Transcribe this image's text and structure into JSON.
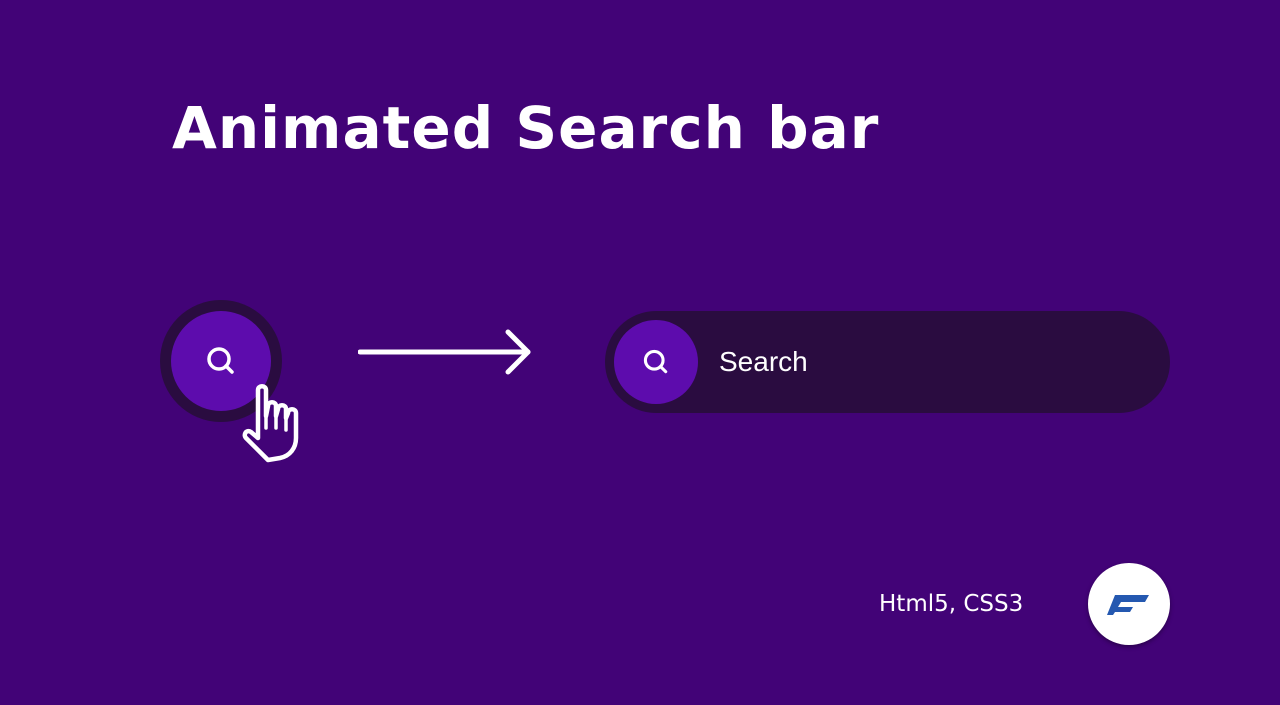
{
  "heading": {
    "title": "Animated Search bar"
  },
  "collapsed_search": {
    "icon": "search-icon",
    "cursor_icon": "hand-pointer-icon"
  },
  "transition_arrow": {
    "icon": "arrow-right-icon"
  },
  "expanded_search": {
    "icon": "search-icon",
    "placeholder": "Search"
  },
  "footer": {
    "tech_label": "Html5, CSS3",
    "logo_icon": "brand-logo-icon"
  },
  "colors": {
    "background": "#420377",
    "button_purple": "#5d0cad",
    "bar_dark": "#2a0c40",
    "text": "#ffffff",
    "logo_blue": "#2458b0"
  }
}
